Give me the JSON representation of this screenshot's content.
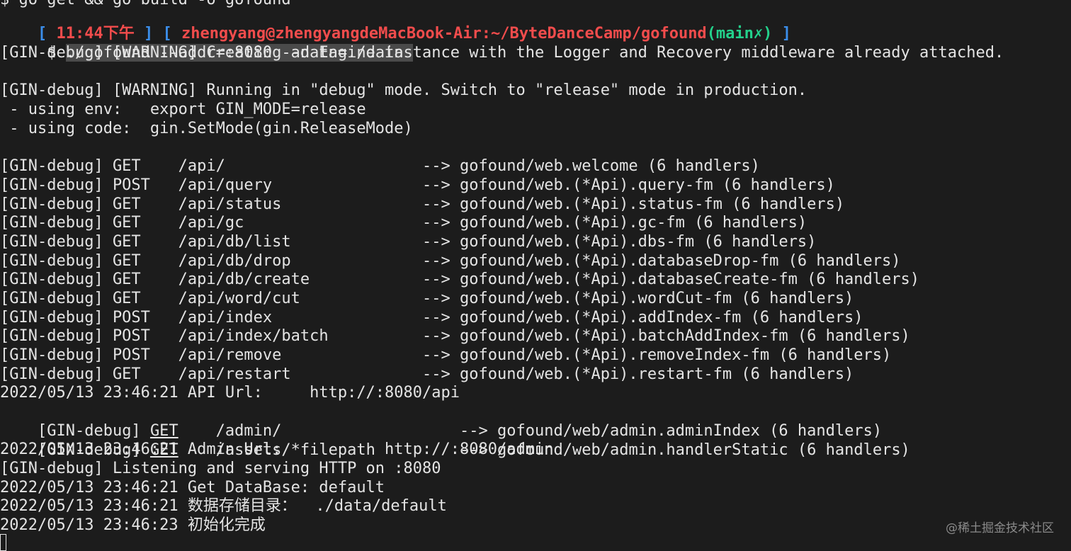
{
  "colors": {
    "background": "#1c1c1c",
    "foreground": "#e4e4e4",
    "bracket": "#3b8eea",
    "prompt_red": "#f14c4c",
    "git_green": "#23d18b"
  },
  "prev_command": "$ go get && go build -o gofound",
  "prompt": {
    "open_bracket": "[ ",
    "time": "11:44下午",
    "mid_bracket": " ] [ ",
    "user_host_path": "zhengyang@zhengyangdeMacBook-Air:~/ByteDanceCamp/gofound",
    "git_branch": "(main✗)",
    "close_bracket": " ]"
  },
  "command": {
    "prefix": " $ ",
    "text": "./gofound --addr=:8080 --data=./data "
  },
  "output": {
    "warn1": "[GIN-debug] [WARNING] Creating an Engine instance with the Logger and Recovery middleware already attached.",
    "warn2": "[GIN-debug] [WARNING] Running in \"debug\" mode. Switch to \"release\" mode in production.",
    "env_line": " - using env:   export GIN_MODE=release",
    "code_line": " - using code:  gin.SetMode(gin.ReleaseMode)",
    "routes": [
      "[GIN-debug] GET    /api/                     --> gofound/web.welcome (6 handlers)",
      "[GIN-debug] POST   /api/query                --> gofound/web.(*Api).query-fm (6 handlers)",
      "[GIN-debug] GET    /api/status               --> gofound/web.(*Api).status-fm (6 handlers)",
      "[GIN-debug] GET    /api/gc                   --> gofound/web.(*Api).gc-fm (6 handlers)",
      "[GIN-debug] GET    /api/db/list              --> gofound/web.(*Api).dbs-fm (6 handlers)",
      "[GIN-debug] GET    /api/db/drop              --> gofound/web.(*Api).databaseDrop-fm (6 handlers)",
      "[GIN-debug] GET    /api/db/create            --> gofound/web.(*Api).databaseCreate-fm (6 handlers)",
      "[GIN-debug] GET    /api/word/cut             --> gofound/web.(*Api).wordCut-fm (6 handlers)",
      "[GIN-debug] POST   /api/index                --> gofound/web.(*Api).addIndex-fm (6 handlers)",
      "[GIN-debug] POST   /api/index/batch          --> gofound/web.(*Api).batchAddIndex-fm (6 handlers)",
      "[GIN-debug] POST   /api/remove               --> gofound/web.(*Api).removeIndex-fm (6 handlers)",
      "[GIN-debug] GET    /api/restart              --> gofound/web.(*Api).restart-fm (6 handlers)"
    ],
    "api_url": "2022/05/13 23:46:21 API Url:     http://:8080/api",
    "admin_route": {
      "prefix": "[GIN-debug] ",
      "method": "GET",
      "rest": "    /admin/                   --> gofound/web/admin.adminIndex (6 handlers)"
    },
    "assets_route": {
      "prefix": "[GIN-debug] ",
      "method": "GET",
      "rest": "    /assets/*filepath         --> gofound/web/admin.handlerStatic (6 handlers)"
    },
    "admin_url": "2022/05/13 23:46:21 Admin Url:           http://:8080/admin",
    "listening": "[GIN-debug] Listening and serving HTTP on :8080",
    "get_db": "2022/05/13 23:46:21 Get DataBase: default",
    "data_dir": "2022/05/13 23:46:21 数据存储目录：  ./data/default",
    "init_done": "2022/05/13 23:46:23 初始化完成"
  },
  "watermark": "@稀土掘金技术社区"
}
